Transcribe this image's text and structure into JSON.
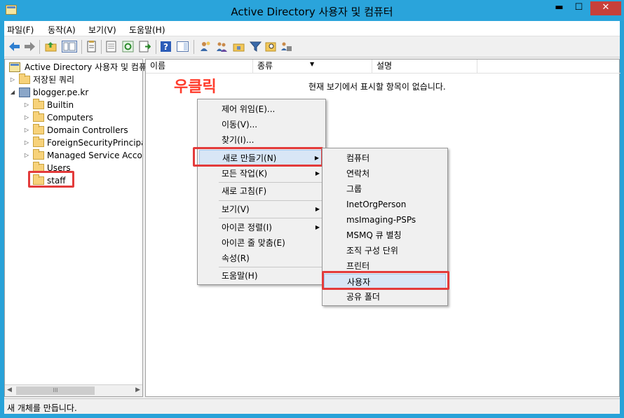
{
  "window": {
    "title": "Active Directory 사용자 및 컴퓨터",
    "minimize_glyph": "▬",
    "maximize_glyph": "☐",
    "close_glyph": "✕"
  },
  "menubar": [
    "파일(F)",
    "동작(A)",
    "보기(V)",
    "도움말(H)"
  ],
  "toolbar": {
    "icons": [
      "back-icon",
      "forward-icon",
      "up-folder-icon",
      "show-tree-icon",
      "properties-icon",
      "export-icon",
      "refresh-icon",
      "export-list-icon",
      "help-icon",
      "action-pane-icon",
      "new-user-icon",
      "new-group-icon",
      "new-ou-icon",
      "filter-icon",
      "find-icon",
      "add-to-group-icon"
    ]
  },
  "tree": {
    "root": "Active Directory 사용자 및 컴퓨",
    "saved_queries": "저장된 쿼리",
    "domain": "blogger.pe.kr",
    "children": [
      "Builtin",
      "Computers",
      "Domain Controllers",
      "ForeignSecurityPrincipal",
      "Managed Service Accou",
      "Users",
      "staff"
    ]
  },
  "list": {
    "columns": [
      "이름",
      "종류",
      "설명"
    ],
    "empty_message": "현재 보기에서 표시할 항목이 없습니다."
  },
  "annotation": {
    "label": "우클릭"
  },
  "context_menu": {
    "items": [
      "제어 위임(E)...",
      "이동(V)...",
      "찾기(I)...",
      "새로 만들기(N)",
      "모든 작업(K)",
      "새로 고침(F)",
      "보기(V)",
      "아이콘 정렬(I)",
      "아이콘 줄 맞춤(E)",
      "속성(R)",
      "도움말(H)"
    ],
    "submenu_arrow": "▶"
  },
  "submenu": {
    "items": [
      "컴퓨터",
      "연락처",
      "그룹",
      "InetOrgPerson",
      "msImaging-PSPs",
      "MSMQ 큐 별칭",
      "조직 구성 단위",
      "프린터",
      "사용자",
      "공유 폴더"
    ]
  },
  "statusbar": {
    "text": "새 개체를 만듭니다."
  },
  "scroll": {
    "left_arrow": "◀",
    "right_arrow": "▶",
    "grip": "III"
  },
  "colors": {
    "title_bar": "#2aa4db",
    "close_button": "#c7403a",
    "highlight_box": "#e33b3b",
    "annotation_text": "#ff3c2c"
  }
}
